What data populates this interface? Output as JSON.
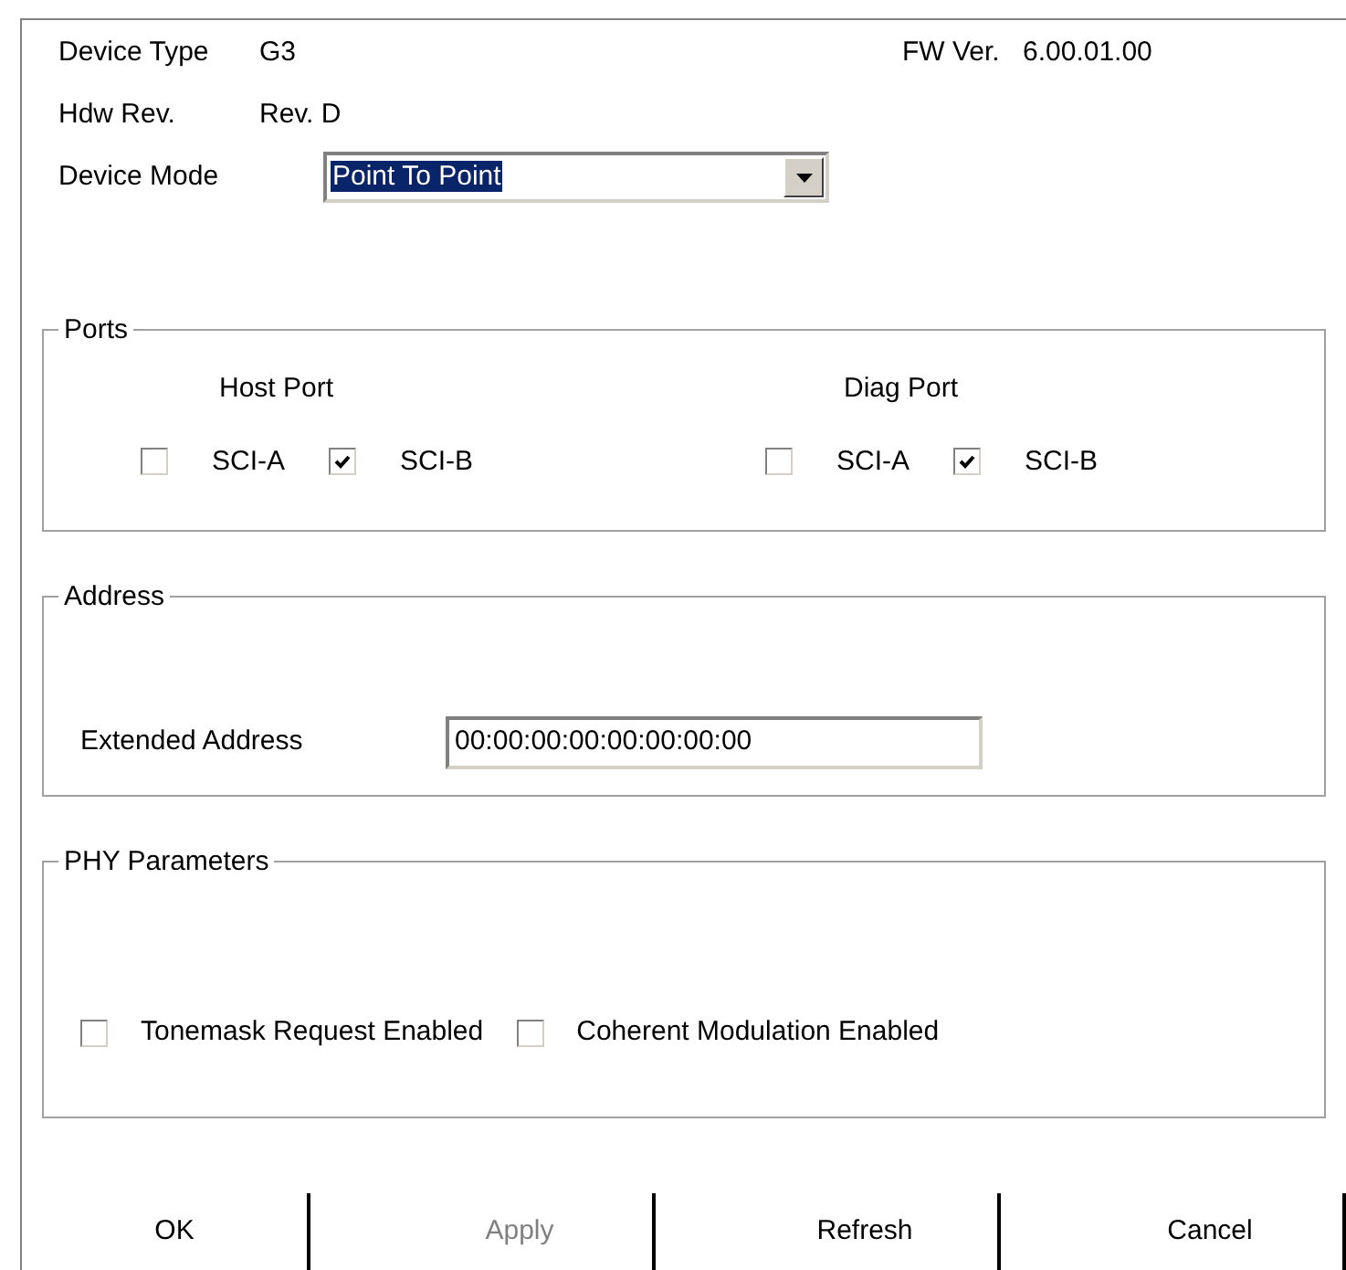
{
  "device_type": {
    "label": "Device Type",
    "value": "G3"
  },
  "fw_version": {
    "label": "FW Ver.",
    "value": "6.00.01.00"
  },
  "hdw_rev": {
    "label": "Hdw Rev.",
    "value": "Rev. D"
  },
  "device_mode": {
    "label": "Device Mode",
    "value": "Point To Point"
  },
  "ports": {
    "title": "Ports",
    "groups": [
      {
        "label": "Host Port",
        "options": [
          {
            "label": "SCI-A",
            "checked": false
          },
          {
            "label": "SCI-B",
            "checked": true
          }
        ]
      },
      {
        "label": "Diag Port",
        "options": [
          {
            "label": "SCI-A",
            "checked": false
          },
          {
            "label": "SCI-B",
            "checked": true
          }
        ]
      }
    ]
  },
  "address": {
    "title": "Address",
    "extended_address": {
      "label": "Extended Address",
      "value": "00:00:00:00:00:00:00:00"
    }
  },
  "phy_parameters": {
    "title": "PHY Parameters",
    "options": [
      {
        "label": "Tonemask Request Enabled",
        "checked": false
      },
      {
        "label": "Coherent Modulation Enabled",
        "checked": false
      }
    ]
  },
  "buttons": [
    {
      "label": "OK",
      "disabled": false
    },
    {
      "label": "Apply",
      "disabled": true
    },
    {
      "label": "Refresh",
      "disabled": false
    },
    {
      "label": "Cancel",
      "disabled": false
    }
  ]
}
